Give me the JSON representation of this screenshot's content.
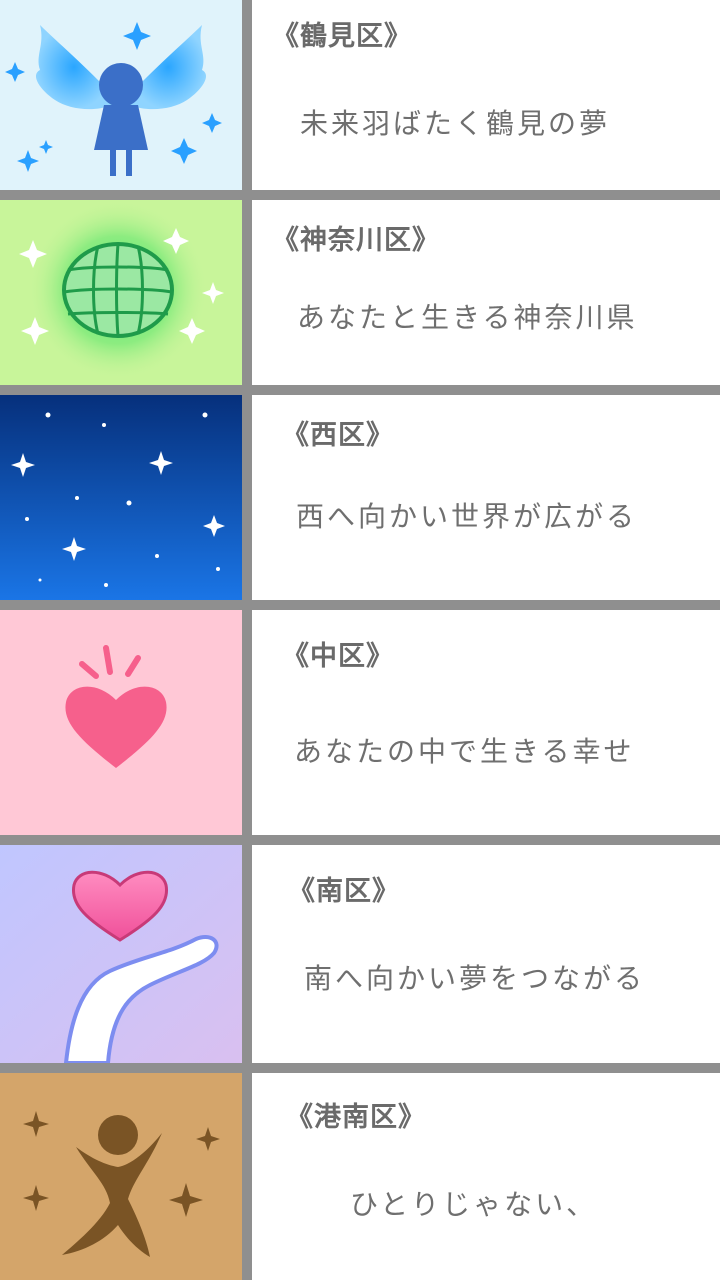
{
  "rows": [
    {
      "ward": "《鶴見区》",
      "phrase": "未来羽ばたく鶴見の夢",
      "icon": "angel-icon",
      "bg": "#e0f3fb"
    },
    {
      "ward": "《神奈川区》",
      "phrase": "あなたと生きる神奈川県",
      "icon": "globe-icon",
      "bg": "#c8f59a"
    },
    {
      "ward": "《西区》",
      "phrase": "西へ向かい世界が広がる",
      "icon": "night-sky-icon",
      "bg": "#1656bd"
    },
    {
      "ward": "《中区》",
      "phrase": "あなたの中で生きる幸せ",
      "icon": "heart-icon",
      "bg": "#ffc8d6"
    },
    {
      "ward": "《南区》",
      "phrase": "南へ向かい夢をつながる",
      "icon": "hand-heart-icon",
      "bg": "#c6c3fb"
    },
    {
      "ward": "《港南区》",
      "phrase": "ひとりじゃない、",
      "icon": "person-sparkle-icon",
      "bg": "#d4a56a"
    }
  ]
}
